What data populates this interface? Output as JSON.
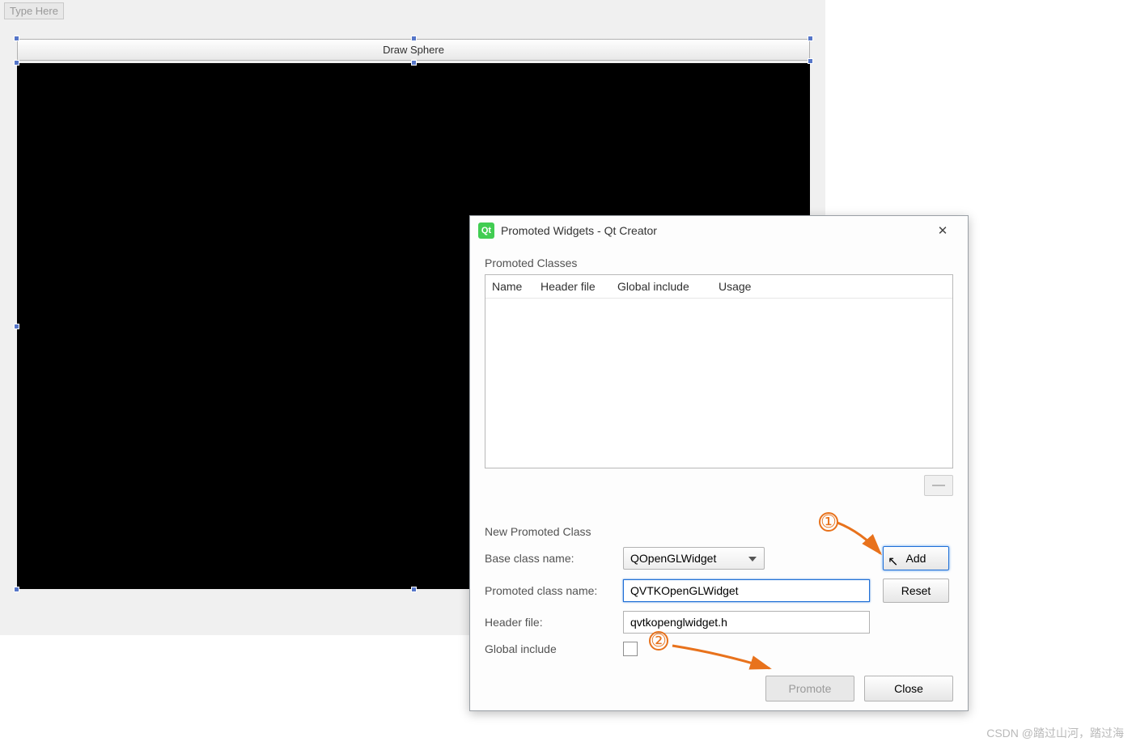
{
  "designer": {
    "menu_placeholder": "Type Here",
    "draw_button_label": "Draw Sphere"
  },
  "dialog": {
    "title": "Promoted Widgets - Qt Creator",
    "promoted_classes_label": "Promoted Classes",
    "table_headers": {
      "name": "Name",
      "header_file": "Header file",
      "global_include": "Global include",
      "usage": "Usage"
    },
    "new_promoted_class_label": "New Promoted Class",
    "form": {
      "base_class_label": "Base class name:",
      "base_class_value": "QOpenGLWidget",
      "promoted_class_label": "Promoted class name:",
      "promoted_class_value": "QVTKOpenGLWidget",
      "header_file_label": "Header file:",
      "header_file_value": "qvtkopenglwidget.h",
      "global_include_label": "Global include"
    },
    "buttons": {
      "add": "Add",
      "reset": "Reset",
      "promote": "Promote",
      "close": "Close",
      "remove_symbol": "—"
    }
  },
  "annotations": {
    "step1": "①",
    "step2": "②"
  },
  "watermark": "CSDN @踏过山河，踏过海"
}
